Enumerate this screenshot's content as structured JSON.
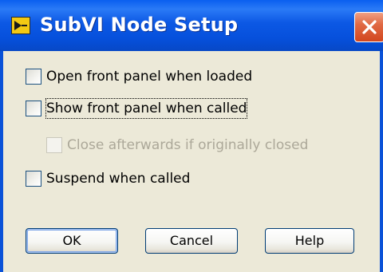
{
  "window": {
    "title": "SubVI Node Setup",
    "icons": {
      "app": "labview-vi-icon",
      "close": "close-icon"
    },
    "colors": {
      "titlebar": "#0a5ff0",
      "close_button": "#e06a45",
      "dialog_background": "#ece9d8"
    }
  },
  "options": {
    "open_front_panel": {
      "label": "Open front panel when loaded",
      "checked": false,
      "enabled": true
    },
    "show_front_panel": {
      "label": "Show front panel when called",
      "checked": false,
      "enabled": true
    },
    "close_afterwards": {
      "label": "Close afterwards if originally closed",
      "checked": false,
      "enabled": false
    },
    "suspend_when_called": {
      "label": "Suspend when called",
      "checked": false,
      "enabled": true
    }
  },
  "buttons": {
    "ok": "OK",
    "cancel": "Cancel",
    "help": "Help"
  }
}
